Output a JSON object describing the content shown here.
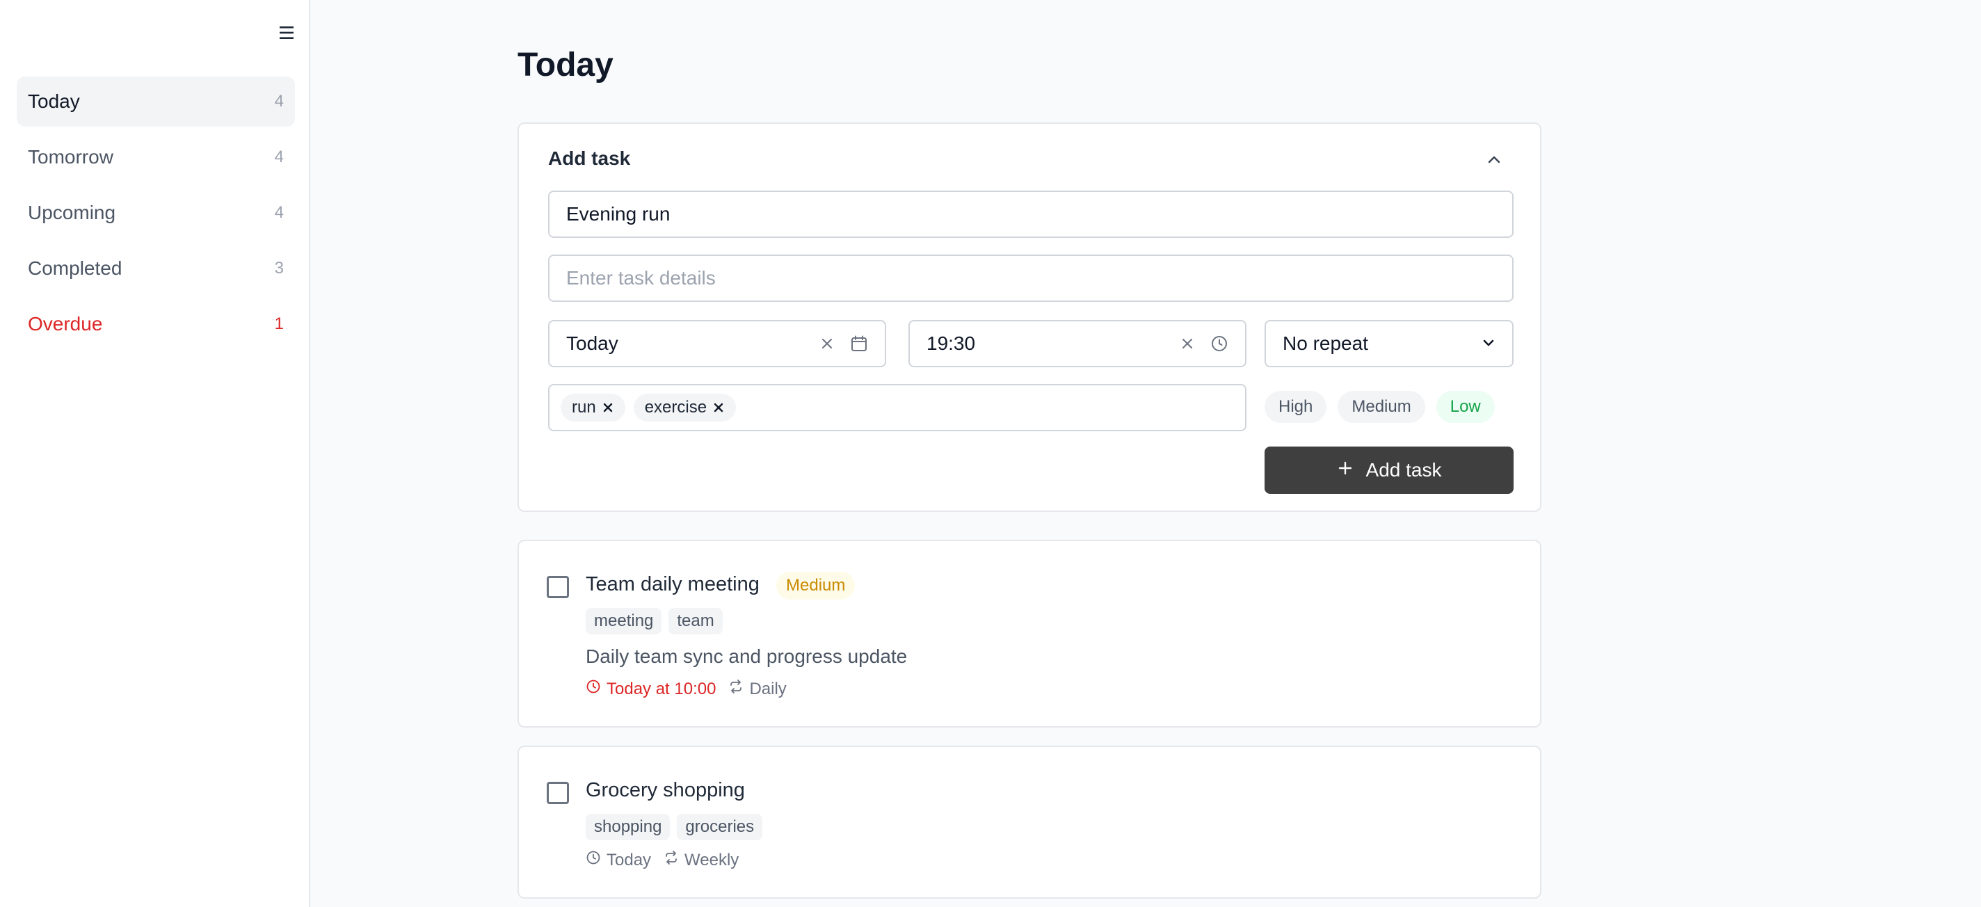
{
  "sidebar": {
    "menu_icon": "hamburger-icon",
    "items": [
      {
        "label": "Today",
        "count": "4"
      },
      {
        "label": "Tomorrow",
        "count": "4"
      },
      {
        "label": "Upcoming",
        "count": "4"
      },
      {
        "label": "Completed",
        "count": "3"
      },
      {
        "label": "Overdue",
        "count": "1"
      }
    ],
    "active_index": 0,
    "colors": {
      "overdue": "#dc2626",
      "active_bg": "#f3f4f6"
    }
  },
  "main": {
    "title": "Today",
    "add_task": {
      "header": "Add task",
      "collapse_icon": "chevron-up-icon",
      "title_value": "Evening run",
      "details_placeholder": "Enter task details",
      "date_value": "Today",
      "time_value": "19:30",
      "repeat_value": "No repeat",
      "tags": [
        "run",
        "exercise"
      ],
      "priorities": [
        "High",
        "Medium",
        "Low"
      ],
      "selected_priority": "Low",
      "submit_label": "Add task",
      "button_color": "#3f3f3f"
    },
    "tasks": [
      {
        "title": "Team daily meeting",
        "priority": "Medium",
        "tags": [
          "meeting",
          "team"
        ],
        "description": "Daily team sync and progress update",
        "due": "Today at 10:00",
        "repeat": "Daily",
        "due_color": "#dc2626"
      },
      {
        "title": "Grocery shopping",
        "tags": [
          "shopping",
          "groceries"
        ],
        "due": "Today",
        "repeat": "Weekly"
      }
    ]
  }
}
